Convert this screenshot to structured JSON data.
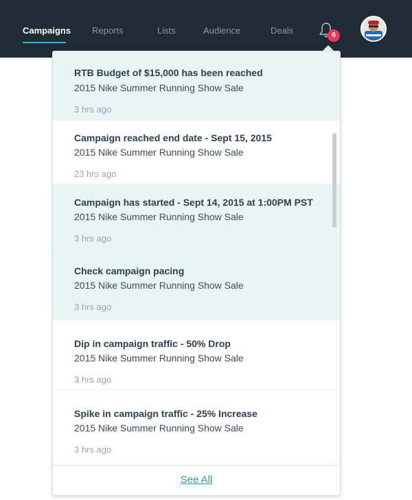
{
  "nav": {
    "items": [
      {
        "label": "Campaigns",
        "active": true
      },
      {
        "label": "Reports",
        "active": false
      },
      {
        "label": "Lists",
        "active": false
      },
      {
        "label": "Audience",
        "active": false
      },
      {
        "label": "Deals",
        "active": false
      }
    ],
    "notification_count": "6",
    "avatar_icon": "user-avatar"
  },
  "colors": {
    "topbar": "#212b35",
    "accent": "#3fb5c9",
    "badge": "#f0365a",
    "unread_bg": "#eaf4f5",
    "link": "#2b9bb4"
  },
  "notifications": [
    {
      "title": "RTB Budget of $15,000 has been reached",
      "campaign": "2015 Nike Summer Running Show Sale",
      "time": "3 hrs ago",
      "unread": true
    },
    {
      "title": "Campaign reached end date - Sept 15, 2015",
      "campaign": "2015 Nike Summer Running Show Sale",
      "time": "23 hrs ago",
      "unread": false
    },
    {
      "title": "Campaign has started - Sept 14, 2015 at 1:00PM PST",
      "campaign": "2015 Nike Summer Running Show Sale",
      "time": "3 hrs ago",
      "unread": true
    },
    {
      "title": "Check campaign pacing",
      "campaign": "2015 Nike Summer Running Show Sale",
      "time": "3 hrs ago",
      "unread": true
    },
    {
      "title": "Dip in campaign traffic - 50% Drop",
      "campaign": "2015 Nike Summer Running Show Sale",
      "time": "3 hrs ago",
      "unread": false
    },
    {
      "title": "Spike in campaign traffic - 25% Increase",
      "campaign": "2015 Nike Summer Running Show Sale",
      "time": "3 hrs ago",
      "unread": false
    }
  ],
  "footer": {
    "see_all_label": "See All"
  }
}
